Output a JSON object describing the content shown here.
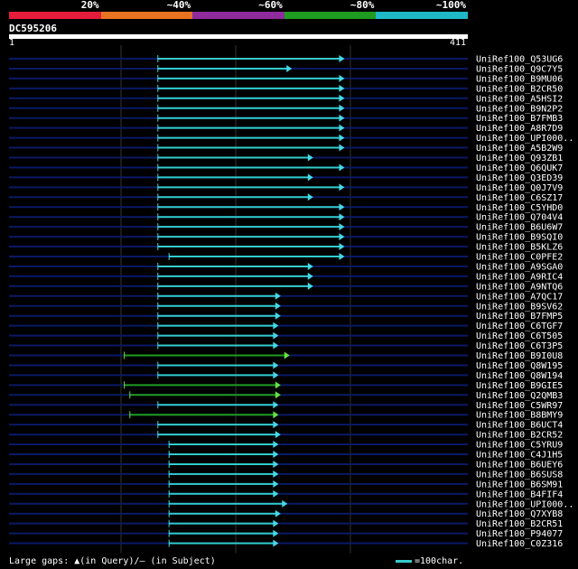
{
  "scale": {
    "segments": [
      {
        "color": "#e51c3a",
        "label": "20%"
      },
      {
        "color": "#e87320",
        "label": "~40%"
      },
      {
        "color": "#8f2b9c",
        "label": "~60%"
      },
      {
        "color": "#1f9b1f",
        "label": "~80%"
      },
      {
        "color": "#1fb8c7",
        "label": "~100%"
      }
    ]
  },
  "query": {
    "name": "DC595206",
    "start_label": "1",
    "end_label": "411",
    "length": 411
  },
  "legend": {
    "gaps_text": "Large gaps: ▲(in Query)/— (in Subject)",
    "scale_text": "=100char."
  },
  "colors": {
    "bar": "#3cc",
    "bar_green": "#1f9b1f",
    "row_line": "#0a1a66",
    "arrow": "#44d8e8",
    "arrow_green": "#66e044",
    "grid": "#333"
  },
  "chart_data": {
    "type": "alignment",
    "x_range": [
      1,
      411
    ],
    "hits": [
      {
        "name": "UniRef100_Q53UG6",
        "start": 134,
        "end": 300,
        "color": "cyan"
      },
      {
        "name": "UniRef100_Q9C7Y5",
        "start": 134,
        "end": 253,
        "color": "cyan"
      },
      {
        "name": "UniRef100_B9MU06",
        "start": 134,
        "end": 300,
        "color": "cyan"
      },
      {
        "name": "UniRef100_B2CR50",
        "start": 134,
        "end": 300,
        "color": "cyan"
      },
      {
        "name": "UniRef100_A5HSI2",
        "start": 134,
        "end": 300,
        "color": "cyan"
      },
      {
        "name": "UniRef100_B9N2P2",
        "start": 134,
        "end": 300,
        "color": "cyan"
      },
      {
        "name": "UniRef100_B7FMB3",
        "start": 134,
        "end": 300,
        "color": "cyan"
      },
      {
        "name": "UniRef100_A8R7D9",
        "start": 134,
        "end": 300,
        "color": "cyan"
      },
      {
        "name": "UniRef100_UPI000..",
        "start": 134,
        "end": 300,
        "color": "cyan"
      },
      {
        "name": "UniRef100_A5B2W9",
        "start": 134,
        "end": 300,
        "color": "cyan"
      },
      {
        "name": "UniRef100_Q93ZB1",
        "start": 134,
        "end": 272,
        "color": "cyan"
      },
      {
        "name": "UniRef100_Q6QUK7",
        "start": 134,
        "end": 300,
        "color": "cyan"
      },
      {
        "name": "UniRef100_Q3ED39",
        "start": 134,
        "end": 272,
        "color": "cyan"
      },
      {
        "name": "UniRef100_Q0J7V9",
        "start": 134,
        "end": 300,
        "color": "cyan"
      },
      {
        "name": "UniRef100_C6SZ17",
        "start": 134,
        "end": 272,
        "color": "cyan"
      },
      {
        "name": "UniRef100_C5YHD0",
        "start": 134,
        "end": 300,
        "color": "cyan"
      },
      {
        "name": "UniRef100_Q704V4",
        "start": 134,
        "end": 300,
        "color": "cyan"
      },
      {
        "name": "UniRef100_B6U6W7",
        "start": 134,
        "end": 300,
        "color": "cyan"
      },
      {
        "name": "UniRef100_B9SQI0",
        "start": 134,
        "end": 300,
        "color": "cyan"
      },
      {
        "name": "UniRef100_B5KLZ6",
        "start": 134,
        "end": 300,
        "color": "cyan"
      },
      {
        "name": "UniRef100_C0PFE2",
        "start": 144,
        "end": 300,
        "color": "cyan"
      },
      {
        "name": "UniRef100_A9SGA0",
        "start": 134,
        "end": 272,
        "color": "cyan"
      },
      {
        "name": "UniRef100_A9RIC4",
        "start": 134,
        "end": 272,
        "color": "cyan"
      },
      {
        "name": "UniRef100_A9NTQ6",
        "start": 134,
        "end": 272,
        "color": "cyan"
      },
      {
        "name": "UniRef100_A7QC17",
        "start": 134,
        "end": 243,
        "color": "cyan"
      },
      {
        "name": "UniRef100_B9SV62",
        "start": 134,
        "end": 243,
        "color": "cyan"
      },
      {
        "name": "UniRef100_B7FMP5",
        "start": 134,
        "end": 243,
        "color": "cyan"
      },
      {
        "name": "UniRef100_C6TGF7",
        "start": 134,
        "end": 241,
        "color": "cyan"
      },
      {
        "name": "UniRef100_C6T505",
        "start": 134,
        "end": 241,
        "color": "cyan"
      },
      {
        "name": "UniRef100_C6T3P5",
        "start": 134,
        "end": 241,
        "color": "cyan"
      },
      {
        "name": "UniRef100_B9I0U8",
        "start": 104,
        "end": 251,
        "color": "green"
      },
      {
        "name": "UniRef100_Q8W195",
        "start": 134,
        "end": 241,
        "color": "cyan"
      },
      {
        "name": "UniRef100_Q8W194",
        "start": 134,
        "end": 241,
        "color": "cyan"
      },
      {
        "name": "UniRef100_B9GIE5",
        "start": 104,
        "end": 243,
        "color": "green"
      },
      {
        "name": "UniRef100_Q2QMB3",
        "start": 109,
        "end": 243,
        "color": "green"
      },
      {
        "name": "UniRef100_C5WR97",
        "start": 134,
        "end": 241,
        "color": "cyan"
      },
      {
        "name": "UniRef100_B8BMY9",
        "start": 109,
        "end": 241,
        "color": "green"
      },
      {
        "name": "UniRef100_B6UCT4",
        "start": 134,
        "end": 241,
        "color": "cyan"
      },
      {
        "name": "UniRef100_B2CR52",
        "start": 134,
        "end": 243,
        "color": "cyan"
      },
      {
        "name": "UniRef100_C5YRU9",
        "start": 144,
        "end": 241,
        "color": "cyan"
      },
      {
        "name": "UniRef100_C4J1H5",
        "start": 144,
        "end": 241,
        "color": "cyan"
      },
      {
        "name": "UniRef100_B6UEY6",
        "start": 144,
        "end": 241,
        "color": "cyan"
      },
      {
        "name": "UniRef100_B6SUS8",
        "start": 144,
        "end": 241,
        "color": "cyan"
      },
      {
        "name": "UniRef100_B6SM91",
        "start": 144,
        "end": 241,
        "color": "cyan"
      },
      {
        "name": "UniRef100_B4FIF4",
        "start": 144,
        "end": 241,
        "color": "cyan"
      },
      {
        "name": "UniRef100_UPI000..",
        "start": 144,
        "end": 249,
        "color": "cyan"
      },
      {
        "name": "UniRef100_Q7XYB8",
        "start": 144,
        "end": 243,
        "color": "cyan"
      },
      {
        "name": "UniRef100_B2CR51",
        "start": 144,
        "end": 241,
        "color": "cyan"
      },
      {
        "name": "UniRef100_P94077",
        "start": 144,
        "end": 241,
        "color": "cyan"
      },
      {
        "name": "UniRef100_C0Z316",
        "start": 144,
        "end": 241,
        "color": "cyan"
      }
    ]
  }
}
